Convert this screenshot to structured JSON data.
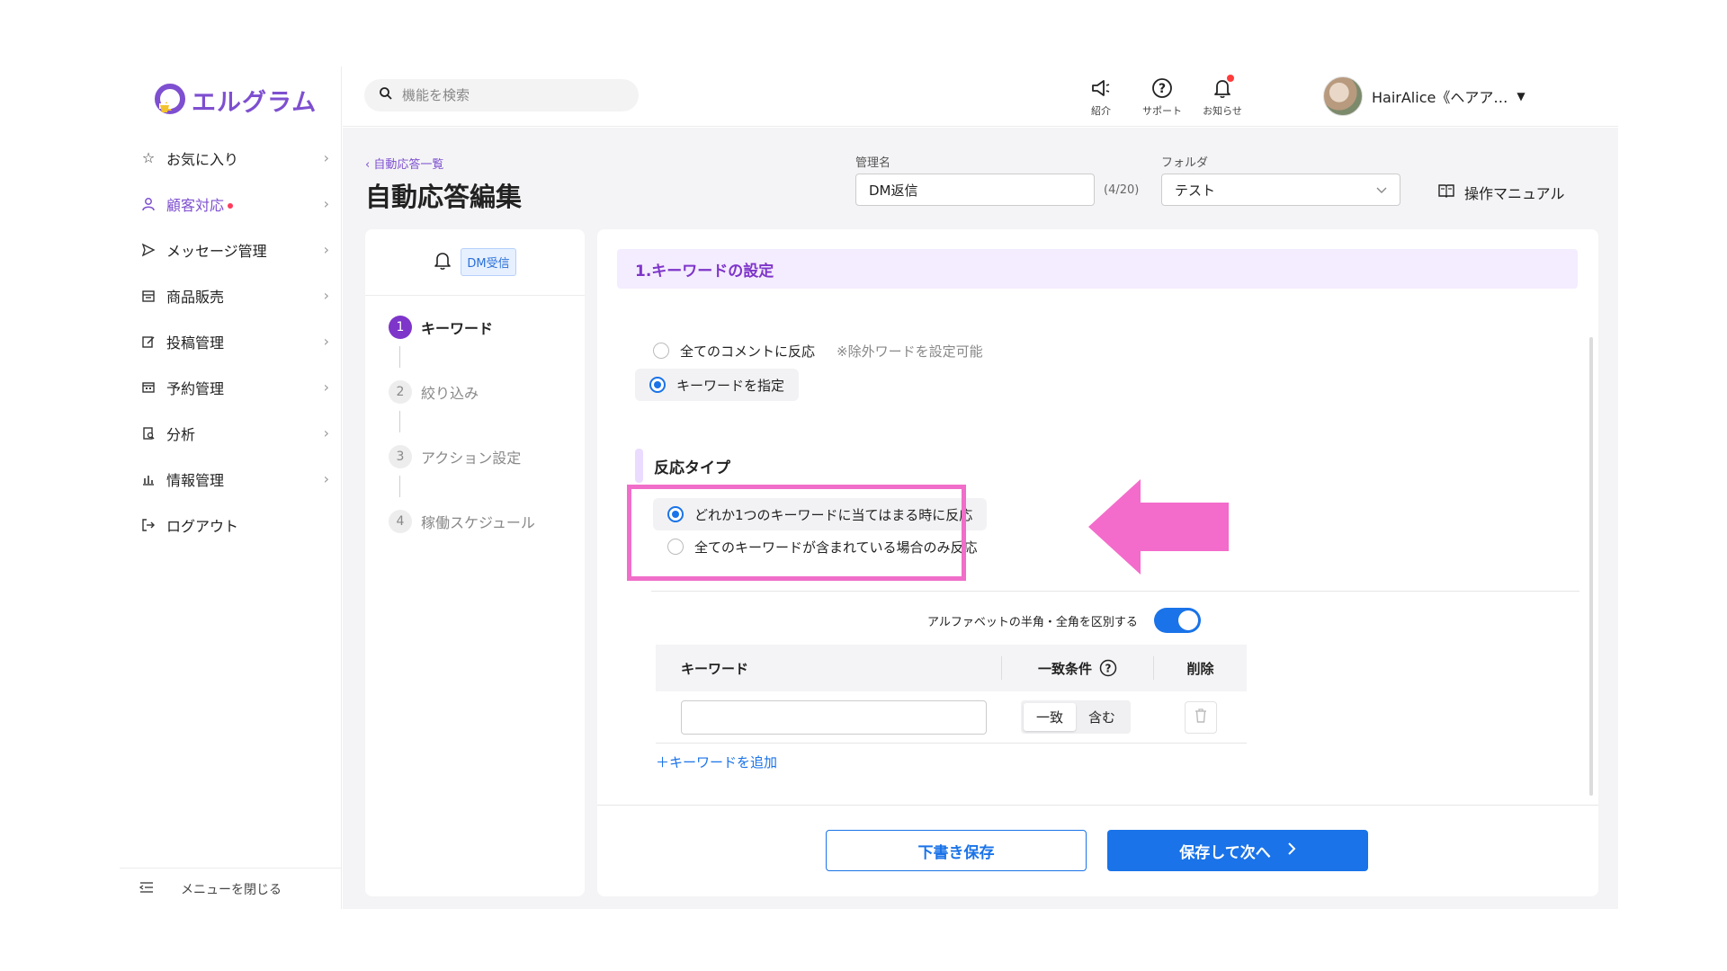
{
  "app": {
    "logo_text": "エルグラム",
    "brand_color": "#7e4fd0",
    "accent_color": "#1a73e8"
  },
  "sidebar": {
    "items": [
      {
        "label": "お気に入り",
        "icon": "star-icon"
      },
      {
        "label": "顧客対応",
        "icon": "person-icon",
        "active": true,
        "badge_dot": true
      },
      {
        "label": "メッセージ管理",
        "icon": "send-icon"
      },
      {
        "label": "商品販売",
        "icon": "store-icon"
      },
      {
        "label": "投稿管理",
        "icon": "edit-icon"
      },
      {
        "label": "予約管理",
        "icon": "calendar-icon"
      },
      {
        "label": "分析",
        "icon": "report-icon"
      },
      {
        "label": "情報管理",
        "icon": "bar-chart-icon"
      },
      {
        "label": "ログアウト",
        "icon": "logout-icon"
      }
    ],
    "close_menu_label": "メニューを閉じる"
  },
  "topbar": {
    "search_placeholder": "機能を検索",
    "icons": [
      {
        "label": "紹介",
        "icon": "megaphone-icon"
      },
      {
        "label": "サポート",
        "icon": "help-icon"
      },
      {
        "label": "お知らせ",
        "icon": "bell-icon"
      }
    ],
    "user_name": "HairAlice《ヘアア…"
  },
  "header": {
    "back_link": "自動応答一覧",
    "title": "自動応答編集",
    "name_label": "管理名",
    "name_value": "DM返信",
    "name_count": "(4/20)",
    "folder_label": "フォルダ",
    "folder_value": "テスト",
    "manual_label": "操作マニュアル"
  },
  "steps": {
    "trigger_badge": "DM受信",
    "items": [
      {
        "num": "1",
        "label": "キーワード",
        "active": true
      },
      {
        "num": "2",
        "label": "絞り込み"
      },
      {
        "num": "3",
        "label": "アクション設定"
      },
      {
        "num": "4",
        "label": "稼働スケジュール"
      }
    ]
  },
  "main": {
    "section_title": "1.キーワードの設定",
    "scope_options": [
      {
        "label": "全てのコメントに反応",
        "note": "※除外ワードを設定可能",
        "selected": false
      },
      {
        "label": "キーワードを指定",
        "selected": true
      }
    ],
    "reaction_type_title": "反応タイプ",
    "reaction_options": [
      {
        "label": "どれか1つのキーワードに当てはまる時に反応",
        "selected": true
      },
      {
        "label": "全てのキーワードが含まれている場合のみ反応",
        "selected": false
      }
    ],
    "toggle_label": "アルファベットの半角・全角を区別する",
    "toggle_on": true,
    "table": {
      "col_keyword": "キーワード",
      "col_match": "一致条件",
      "col_delete": "削除",
      "match_options": [
        "一致",
        "含む"
      ],
      "match_selected": "一致"
    },
    "add_keyword": "＋キーワードを追加",
    "draft_button": "下書き保存",
    "next_button": "保存して次へ"
  },
  "annotation_color": "#f06ec9"
}
